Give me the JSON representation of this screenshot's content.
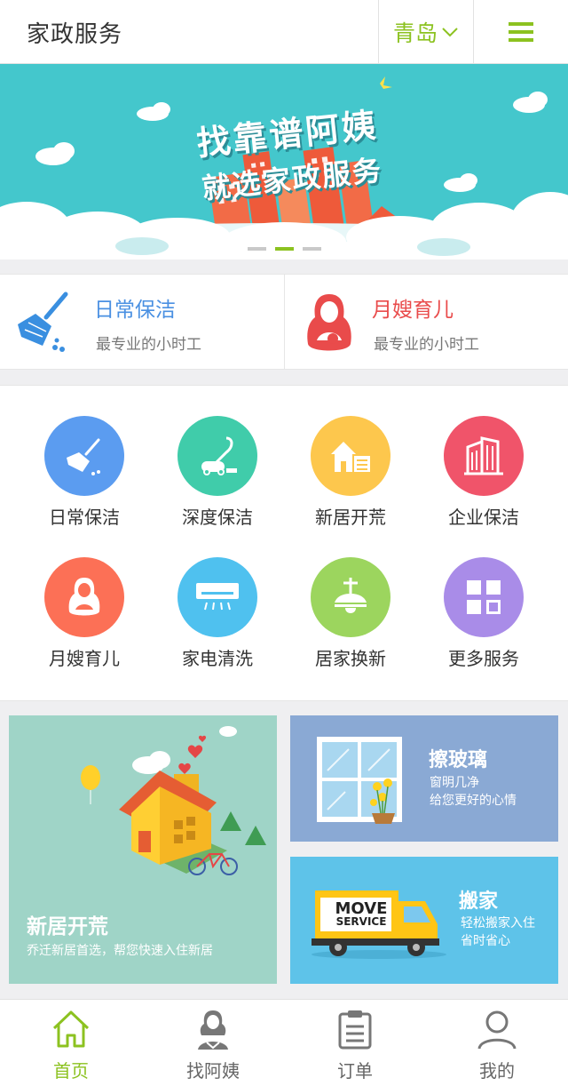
{
  "header": {
    "title": "家政服务",
    "city": "青岛",
    "menu_icon": "hamburger-menu-icon"
  },
  "banner": {
    "line1": "找靠谱阿姨",
    "line2": "就选家政服务",
    "slide_count": 3,
    "active_slide": 2
  },
  "featured": [
    {
      "title": "日常保洁",
      "subtitle": "最专业的小时工",
      "color": "#4a90e2",
      "icon": "broom-icon"
    },
    {
      "title": "月嫂育儿",
      "subtitle": "最专业的小时工",
      "color": "#e94b4b",
      "icon": "nanny-icon"
    }
  ],
  "services": [
    {
      "label": "日常保洁",
      "color": "#5b9cf0",
      "icon": "broom-icon"
    },
    {
      "label": "深度保洁",
      "color": "#40ccaa",
      "icon": "vacuum-icon"
    },
    {
      "label": "新居开荒",
      "color": "#fdc74d",
      "icon": "house-icon"
    },
    {
      "label": "企业保洁",
      "color": "#f0546a",
      "icon": "building-icon"
    },
    {
      "label": "月嫂育儿",
      "color": "#fc7056",
      "icon": "nanny-icon"
    },
    {
      "label": "家电清洗",
      "color": "#4fc1ef",
      "icon": "air-conditioner-icon"
    },
    {
      "label": "居家换新",
      "color": "#9cd55e",
      "icon": "lamp-icon"
    },
    {
      "label": "更多服务",
      "color": "#a98ce8",
      "icon": "grid-icon"
    }
  ],
  "promos": {
    "left": {
      "title": "新居开荒",
      "subtitle": "乔迁新居首选，帮您快速入住新居"
    },
    "top_right": {
      "title": "擦玻璃",
      "line1": "窗明几净",
      "line2": "给您更好的心情"
    },
    "bottom_right": {
      "title": "搬家",
      "line1": "轻松搬家入住",
      "line2": "省时省心",
      "truck_text1": "MOVE",
      "truck_text2": "SERVICE"
    }
  },
  "tabbar": [
    {
      "label": "首页",
      "icon": "home-icon",
      "active": true
    },
    {
      "label": "找阿姨",
      "icon": "nanny-icon",
      "active": false
    },
    {
      "label": "订单",
      "icon": "clipboard-icon",
      "active": false
    },
    {
      "label": "我的",
      "icon": "user-icon",
      "active": false
    }
  ],
  "colors": {
    "accent": "#8cc220",
    "banner_bg": "#44c7cc"
  }
}
